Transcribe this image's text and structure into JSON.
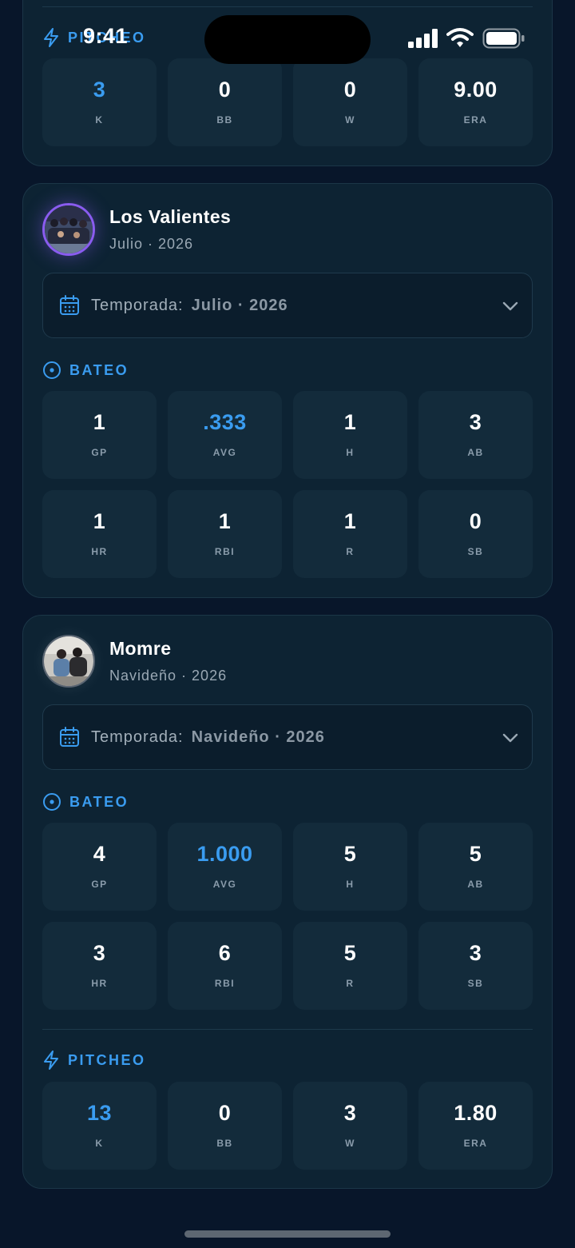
{
  "status_bar": {
    "time": "9:41"
  },
  "cards": [
    {
      "pitcheo": {
        "title": "PITCHEO",
        "stats": [
          {
            "value": "3",
            "label": "K",
            "accent": true
          },
          {
            "value": "0",
            "label": "BB",
            "accent": false
          },
          {
            "value": "0",
            "label": "W",
            "accent": false
          },
          {
            "value": "9.00",
            "label": "ERA",
            "accent": false
          }
        ]
      }
    },
    {
      "team_name": "Los Valientes",
      "season_sub": "Julio · 2026",
      "season_label": "Temporada:",
      "season_value": "Julio · 2026",
      "bateo": {
        "title": "BATEO",
        "row1": [
          {
            "value": "1",
            "label": "GP"
          },
          {
            "value": ".333",
            "label": "AVG"
          },
          {
            "value": "1",
            "label": "H"
          },
          {
            "value": "3",
            "label": "AB"
          }
        ],
        "row2": [
          {
            "value": "1",
            "label": "HR"
          },
          {
            "value": "1",
            "label": "RBI"
          },
          {
            "value": "1",
            "label": "R"
          },
          {
            "value": "0",
            "label": "SB"
          }
        ]
      }
    },
    {
      "team_name": "Momre",
      "season_sub": "Navideño · 2026",
      "season_label": "Temporada:",
      "season_value": "Navideño · 2026",
      "bateo": {
        "title": "BATEO",
        "row1": [
          {
            "value": "4",
            "label": "GP"
          },
          {
            "value": "1.000",
            "label": "AVG"
          },
          {
            "value": "5",
            "label": "H"
          },
          {
            "value": "5",
            "label": "AB"
          }
        ],
        "row2": [
          {
            "value": "3",
            "label": "HR"
          },
          {
            "value": "6",
            "label": "RBI"
          },
          {
            "value": "5",
            "label": "R"
          },
          {
            "value": "3",
            "label": "SB"
          }
        ]
      },
      "pitcheo": {
        "title": "PITCHEO",
        "stats": [
          {
            "value": "13",
            "label": "K"
          },
          {
            "value": "0",
            "label": "BB"
          },
          {
            "value": "3",
            "label": "W"
          },
          {
            "value": "1.80",
            "label": "ERA"
          }
        ]
      }
    }
  ],
  "colors": {
    "accent": "#3a9cf0",
    "card_bg": "#0d2333",
    "page_bg": "#08162a",
    "avatar_ring": "#8a5cf0"
  },
  "icons": [
    "bolt-icon",
    "target-icon",
    "calendar-icon",
    "chevron-down-icon",
    "signal-icon",
    "wifi-icon",
    "battery-icon"
  ]
}
